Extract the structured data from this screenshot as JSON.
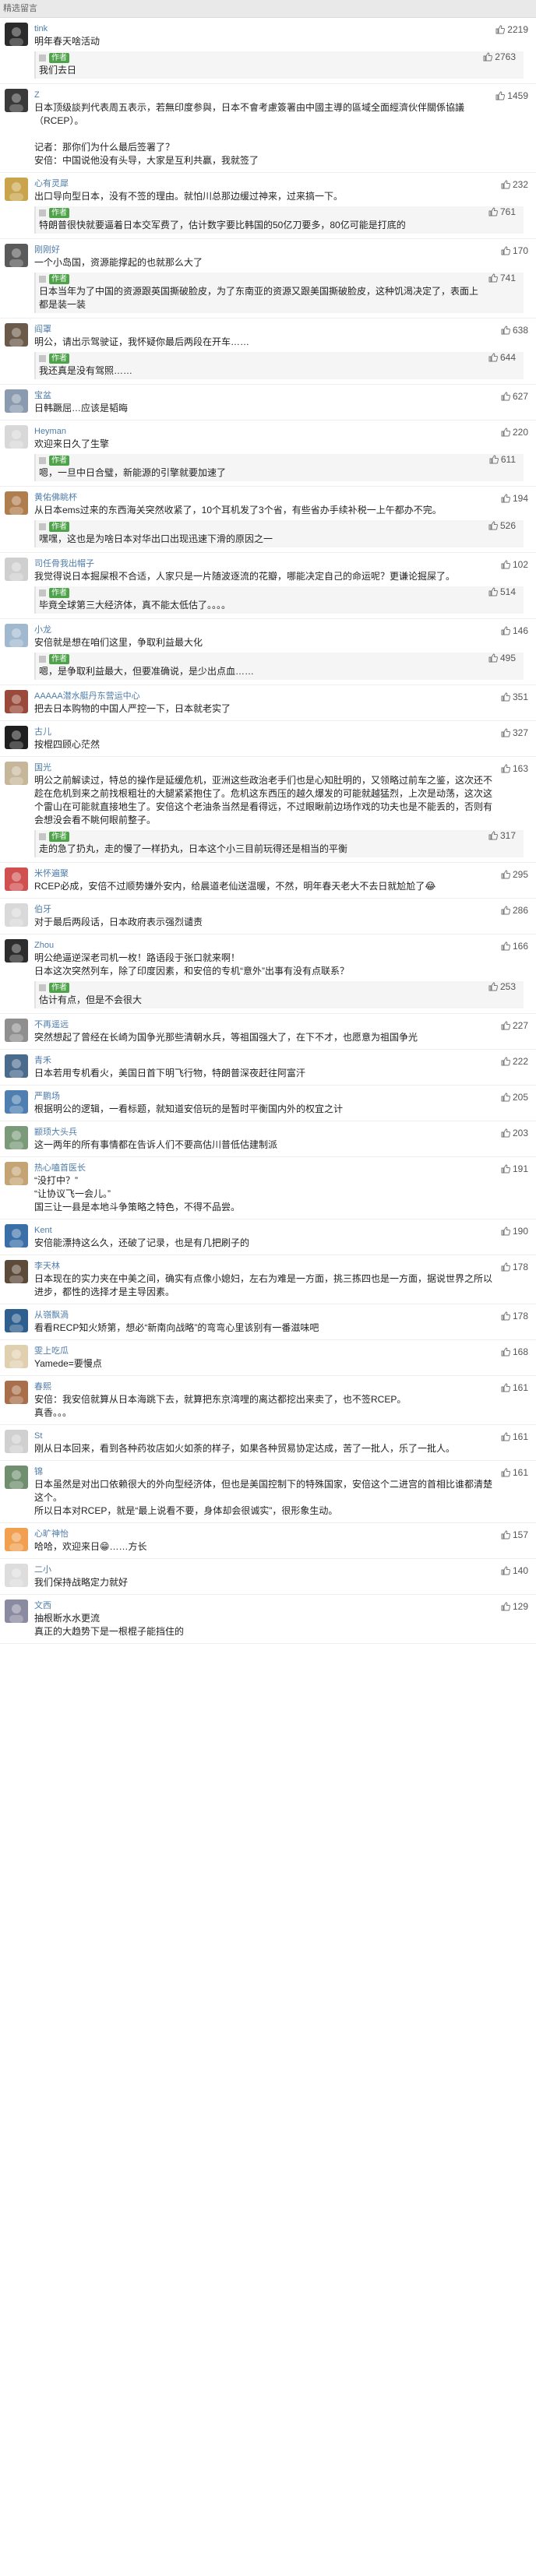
{
  "header": {
    "title": "精选留言"
  },
  "comments": [
    {
      "user": "tink",
      "likes": "2219",
      "text": "明年春天啥活动",
      "reply": {
        "author": "作者",
        "likes": "2763",
        "text": "我们去日"
      },
      "avatar_color": "#2b2b2b"
    },
    {
      "user": "Z",
      "likes": "1459",
      "text": "日本顶级談判代表周五表示，若無印度参與，日本不會考慮簽署由中國主導的區域全面經濟伙伴關係協議（RCEP）。\n\n记者：那你们为什么最后签署了？\n安倍：中国说他没有头导，大家是互利共赢，我就签了",
      "reply": null,
      "avatar_color": "#3a3a3a"
    },
    {
      "user": "心有灵犀",
      "likes": "232",
      "text": "出口导向型日本，没有不签的理由。就怕川总那边缓过神来，过来搞一下。",
      "reply": {
        "author": "作者",
        "likes": "761",
        "text": "特朗普很快就要逼着日本交军费了，估计数字要比韩国的50亿刀要多，80亿可能是打底的"
      },
      "avatar_color": "#c9a44c"
    },
    {
      "user": "刚刚好",
      "likes": "170",
      "text": "一个小岛国，资源能撑起的也就那么大了",
      "reply": {
        "author": "作者",
        "likes": "741",
        "text": "日本当年为了中国的资源跟英国撕破脸皮，为了东南亚的资源又跟美国撕破脸皮，这种饥渴决定了，表面上都是装一装"
      },
      "avatar_color": "#5a5a5a"
    },
    {
      "user": "阎罩",
      "likes": "638",
      "text": "明公，请出示驾驶证，我怀疑你最后两段在开车……",
      "reply": {
        "author": "作者",
        "likes": "644",
        "text": "我还真是没有驾照……"
      },
      "avatar_color": "#6b5a4a"
    },
    {
      "user": "宝盆",
      "likes": "627",
      "text": "日韩蹶屈…应该是韬晦",
      "reply": null,
      "avatar_color": "#8a9bb0"
    },
    {
      "user": "Heyman",
      "likes": "220",
      "text": "欢迎来日久了生擎",
      "reply": {
        "author": "作者",
        "likes": "611",
        "text": "嗯，一旦中日合璧，新能源的引擎就要加速了"
      },
      "avatar_color": "#d8d8d8"
    },
    {
      "user": "黄佑佛眺杯",
      "likes": "194",
      "text": "从日本ems过来的东西海关突然收紧了，10个耳机发了3个省，有些省办手续补税一上午都办不完。",
      "reply": {
        "author": "作者",
        "likes": "526",
        "text": "嘿嘿，这也是为啥日本对华出口出现迅速下滑的原因之一"
      },
      "avatar_color": "#b07d4f"
    },
    {
      "user": "司任骨我出帽子",
      "likes": "102",
      "text": "我觉得说日本掘屎根不合适，人家只是一片随波逐流的花瓣，哪能决定自己的命运呢？更谦论掘屎了。",
      "reply": {
        "author": "作者",
        "likes": "514",
        "text": "毕竟全球第三大经济体，真不能太低估了。。。。"
      },
      "avatar_color": "#cfcfcf"
    },
    {
      "user": "小龙",
      "likes": "146",
      "text": "安倍就是想在咱们这里，争取利益最大化",
      "reply": {
        "author": "作者",
        "likes": "495",
        "text": "嗯，是争取利益最大，但要准确说，是少出点血……"
      },
      "avatar_color": "#a0b9cf"
    },
    {
      "user": "AAAAA潜水艇丹东营运中心",
      "likes": "351",
      "text": "把去日本购物的中国人严控一下，日本就老实了",
      "reply": null,
      "avatar_color": "#9a4a3a"
    },
    {
      "user": "古儿",
      "likes": "327",
      "text": "按棍四顾心茫然",
      "reply": null,
      "avatar_color": "#1f1f1f"
    },
    {
      "user": "国光",
      "likes": "163",
      "text": "明公之前解读过，特总的操作是延缓危机，亚洲这些政治老手们也是心知肚明的，又领略过前车之鉴，这次还不趁在危机到来之前找根粗壮的大腿紧紧抱住了。危机这东西压的越久爆发的可能就越猛烈，上次是动荡，这次这个雷山在可能就直接地生了。安倍这个老油条当然是看得远，不过眼瞅前边场作戏的功夫也是不能丢的，否则有会想没会看不眺何眼前整子。",
      "reply": {
        "author": "作者",
        "likes": "317",
        "text": "走的急了扔丸，走的慢了一样扔丸，日本这个小三目前玩得还是相当的平衡"
      },
      "avatar_color": "#c7b79a"
    },
    {
      "user": "米怀遍聚",
      "likes": "295",
      "text": "RCEP必成，安倍不过顺势嫌外安内，给晨道老仙送温暖，不然，明年春天老大不去日就尬尬了😂",
      "reply": null,
      "avatar_color": "#d05050"
    },
    {
      "user": "伯牙",
      "likes": "286",
      "text": "对于最后两段话，日本政府表示强烈谴责",
      "reply": null,
      "avatar_color": "#d9d9d9"
    },
    {
      "user": "Zhou",
      "likes": "166",
      "text": "明公绝逼逆深老司机一枚！路语段于张口就来啊！\n日本这次突然列车，除了印度因素，和安倍的专机“意外”出事有没有点联系？",
      "reply": {
        "author": "作者",
        "likes": "253",
        "text": "估计有点，但是不会很大"
      },
      "avatar_color": "#2d2d2d"
    },
    {
      "user": "不再遥远",
      "likes": "227",
      "text": "突然想起了曾经在长崎为国争光那些清朝水兵，等祖国强大了，在下不才，也愿意为祖国争光",
      "reply": null,
      "avatar_color": "#8f8f8f"
    },
    {
      "user": "青禾",
      "likes": "222",
      "text": "日本若用专机看火，美国日首下明飞行物，特朗普深夜赶往阿富汗",
      "reply": null,
      "avatar_color": "#4a6b8c"
    },
    {
      "user": "严鹏场",
      "likes": "205",
      "text": "根据明公的逻辑，一看标题，就知道安倍玩的是暂时平衡国内外的权宜之计",
      "reply": null,
      "avatar_color": "#4e7fb0"
    },
    {
      "user": "颛顼大头兵",
      "likes": "203",
      "text": "这一两年的所有事情都在告诉人们不要高估川普低估建制派",
      "reply": null,
      "avatar_color": "#7a9a7a"
    },
    {
      "user": "热心嗑首医长",
      "likes": "191",
      "text": "“没打中？”\n“让协议飞一会儿。”\n国三让一县是本地斗争策略之特色，不得不品尝。",
      "reply": null,
      "avatar_color": "#c4a474"
    },
    {
      "user": "Kent",
      "likes": "190",
      "text": "安倍能漂持这么久，还破了记录，也是有几把刷子的",
      "reply": null,
      "avatar_color": "#3b6fa8"
    },
    {
      "user": "李天林",
      "likes": "178",
      "text": "日本现在的实力夹在中美之间，确实有点像小媳妇，左右为难是一方面，挑三拣四也是一方面，据说世界之所以进步，都性的选择才是主导因素。",
      "reply": null,
      "avatar_color": "#5c4a3a"
    },
    {
      "user": "从嶺飘渦",
      "likes": "178",
      "text": "看看RECP知火矫第，想必“新南向战略”的弯弯心里该别有一番滋味吧",
      "reply": null,
      "avatar_color": "#2f5f8f"
    },
    {
      "user": "雯上吃瓜",
      "likes": "168",
      "text": "Yamede=要慢点",
      "reply": null,
      "avatar_color": "#e0d0b0"
    },
    {
      "user": "春熙",
      "likes": "161",
      "text": "安倍：我安倍就算从日本海跳下去，就算把东京湾哩的离达都挖出来卖了，也不签RCEP。\n真香。。。",
      "reply": null,
      "avatar_color": "#a86f4a"
    },
    {
      "user": "St",
      "likes": "161",
      "text": "刚从日本回来，看到各种药妆店如火如荼的样子，如果各种贸易协定达成，苦了一批人，乐了一批人。",
      "reply": null,
      "avatar_color": "#d0d0d0"
    },
    {
      "user": "锦",
      "likes": "161",
      "text": "日本虽然是对出口依赖很大的外向型经济体，但也是美国控制下的特殊国家，安倍这个二进宫的首相比谁都清楚这个。\n所以日本对RCEP，就是“最上说看不要，身体却会很诚实”，很形象生动。",
      "reply": null,
      "avatar_color": "#6f8f6f"
    },
    {
      "user": "心旷神怡",
      "likes": "157",
      "text": "哈哈，欢迎来日😁……方长",
      "reply": null,
      "avatar_color": "#f0a050"
    },
    {
      "user": "二小",
      "likes": "140",
      "text": "我们保持战略定力就好",
      "reply": null,
      "avatar_color": "#dddddd"
    },
    {
      "user": "文西",
      "likes": "129",
      "text": "抽根断水水更流\n真正的大趋势下是一根棍子能挡住的",
      "reply": null,
      "avatar_color": "#8a8aa0"
    }
  ]
}
